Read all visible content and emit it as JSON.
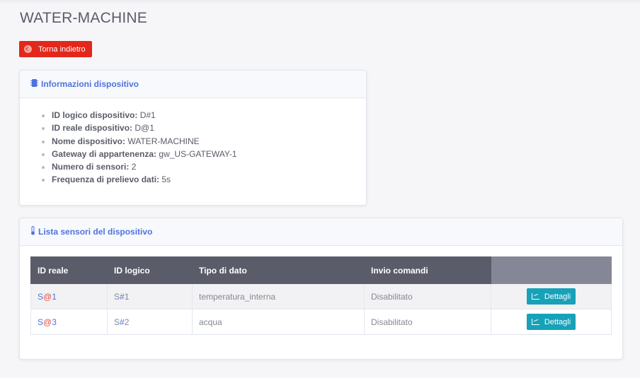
{
  "page": {
    "title": "WATER-MACHINE",
    "back_label": "Torna indietro"
  },
  "info_card": {
    "header": "Informazioni dispositivo",
    "items": [
      {
        "label": "ID logico dispositivo:",
        "value_pre": "D",
        "value_hl": "#",
        "value_post": "1"
      },
      {
        "label": "ID reale dispositivo:",
        "value_pre": "D",
        "value_hl": "@",
        "value_post": "1"
      },
      {
        "label": "Nome dispositivo:",
        "value": "WATER-MACHINE"
      },
      {
        "label": "Gateway di appartenenza:",
        "value": "gw_US-GATEWAY-1"
      },
      {
        "label": "Numero di sensori:",
        "value": "2"
      },
      {
        "label": "Frequenza di prelievo dati:",
        "value": "5s"
      }
    ]
  },
  "sensors_card": {
    "header": "Lista sensori del dispositivo",
    "columns": [
      "ID reale",
      "ID logico",
      "Tipo di dato",
      "Invio comandi",
      ""
    ],
    "rows": [
      {
        "id_reale_pre": "S",
        "id_reale_hl": "@",
        "id_reale_post": "1",
        "id_logico_pre": "S",
        "id_logico_hl": "#",
        "id_logico_post": "1",
        "tipo": "temperatura_interna",
        "invio": "Disabilitato",
        "action": "Dettagli"
      },
      {
        "id_reale_pre": "S",
        "id_reale_hl": "@",
        "id_reale_post": "3",
        "id_logico_pre": "S",
        "id_logico_hl": "#",
        "id_logico_post": "2",
        "tipo": "acqua",
        "invio": "Disabilitato",
        "action": "Dettagli"
      }
    ]
  },
  "colors": {
    "accent": "#4e73df",
    "danger": "#e3271b",
    "info": "#17a2b8",
    "header_dark": "#5a5c69"
  },
  "icons": {
    "back": "circle-left-icon",
    "chip": "microchip-icon",
    "thermometer": "thermometer-icon",
    "chart": "chart-area-icon"
  }
}
